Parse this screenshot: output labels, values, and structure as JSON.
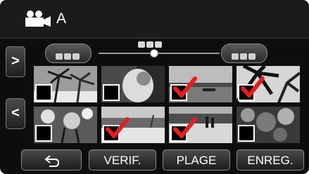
{
  "header": {
    "title": "A",
    "mode_icon": "movie-camera-icon"
  },
  "navigation": {
    "next_page_glyph": ">",
    "prev_page_glyph": "<"
  },
  "thumbnails": [
    {
      "scene": "palm-trees",
      "checked": false
    },
    {
      "scene": "person-portrait",
      "checked": false
    },
    {
      "scene": "sea-horizon",
      "checked": true
    },
    {
      "scene": "palm-leaves",
      "checked": true
    },
    {
      "scene": "flowers-plants",
      "checked": false
    },
    {
      "scene": "beach-shore",
      "checked": true
    },
    {
      "scene": "beach-people",
      "checked": true
    },
    {
      "scene": "foliage",
      "checked": false
    }
  ],
  "buttons": {
    "back_icon": "return-arrow-icon",
    "verif": "VERIF.",
    "plage": "PLAGE",
    "enreg": "ENREG."
  },
  "colors": {
    "checkmark": "#e02020",
    "background": "#0d0d0d"
  }
}
